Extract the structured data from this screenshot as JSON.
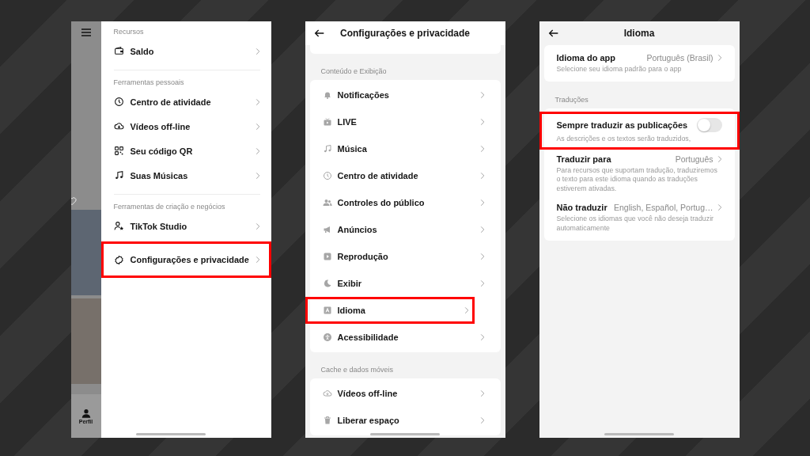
{
  "drawer_screen": {
    "feed_tab": "Perfil",
    "sections": [
      {
        "header": "Recursos",
        "items": [
          {
            "kind": "wallet",
            "label": "Saldo",
            "highlighted": false
          }
        ]
      },
      {
        "header": "Ferramentas pessoais",
        "items": [
          {
            "kind": "clock",
            "label": "Centro de atividade",
            "highlighted": false
          },
          {
            "kind": "cloud",
            "label": "Vídeos off-line",
            "highlighted": false
          },
          {
            "kind": "qr",
            "label": "Seu código QR",
            "highlighted": false
          },
          {
            "kind": "music",
            "label": "Suas Músicas",
            "highlighted": false
          }
        ]
      },
      {
        "header": "Ferramentas de criação e negócios",
        "items": [
          {
            "kind": "studio",
            "label": "TikTok Studio",
            "highlighted": false
          },
          {
            "kind": "gear",
            "label": "Configurações e privacidade",
            "highlighted": true
          }
        ]
      }
    ]
  },
  "settings_screen": {
    "title": "Configurações e privacidade",
    "sections": [
      {
        "header": "Conteúdo e Exibição",
        "items": [
          {
            "kind": "bell",
            "label": "Notificações",
            "highlighted": false
          },
          {
            "kind": "tv",
            "label": "LIVE",
            "highlighted": false
          },
          {
            "kind": "music",
            "label": "Música",
            "highlighted": false
          },
          {
            "kind": "clock",
            "label": "Centro de atividade",
            "highlighted": false
          },
          {
            "kind": "people",
            "label": "Controles do público",
            "highlighted": false
          },
          {
            "kind": "megaphone",
            "label": "Anúncios",
            "highlighted": false
          },
          {
            "kind": "play",
            "label": "Reprodução",
            "highlighted": false
          },
          {
            "kind": "moon",
            "label": "Exibir",
            "highlighted": false
          },
          {
            "kind": "letter",
            "label": "Idioma",
            "highlighted": true
          },
          {
            "kind": "access",
            "label": "Acessibilidade",
            "highlighted": false
          }
        ]
      },
      {
        "header": "Cache e dados móveis",
        "items": [
          {
            "kind": "cloud",
            "label": "Vídeos off-line",
            "highlighted": false
          },
          {
            "kind": "trash",
            "label": "Liberar espaço",
            "highlighted": false
          }
        ]
      }
    ]
  },
  "language_screen": {
    "title": "Idioma",
    "app_language": {
      "label": "Idioma do app",
      "value": "Português (Brasil)",
      "description": "Selecione seu idioma padrão para o app"
    },
    "translations_header": "Traduções",
    "settings": [
      {
        "kind": "toggle",
        "label": "Sempre traduzir as publicações",
        "on": false,
        "highlighted": true,
        "description": "As descrições e os textos serão traduzidos,"
      },
      {
        "kind": "link",
        "label": "Traduzir para",
        "value": "Português",
        "highlighted": false,
        "description": "Para recursos que suportam tradução, traduziremos o texto para este idioma quando as traduções estiverem ativadas."
      },
      {
        "kind": "link",
        "label": "Não traduzir",
        "value": "English, Español, Portug…",
        "highlighted": false,
        "description": "Selecione os idiomas que você não deseja traduzir automaticamente"
      }
    ]
  }
}
